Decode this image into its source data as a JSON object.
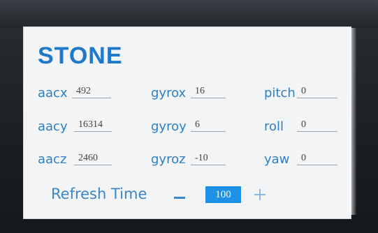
{
  "title": "STONE",
  "accelerometer": {
    "aacx": {
      "label": "aacx",
      "value": "492"
    },
    "aacy": {
      "label": "aacy",
      "value": "16314"
    },
    "aacz": {
      "label": "aacz",
      "value": "2460"
    }
  },
  "gyroscope": {
    "gyrox": {
      "label": "gyrox",
      "value": "16"
    },
    "gyroy": {
      "label": "gyroy",
      "value": "6"
    },
    "gyroz": {
      "label": "gyroz",
      "value": "-10"
    }
  },
  "attitude": {
    "pitch": {
      "label": "pitch",
      "value": "0"
    },
    "roll": {
      "label": "roll",
      "value": "0"
    },
    "yaw": {
      "label": "yaw",
      "value": "0"
    }
  },
  "refresh": {
    "label": "Refresh Time",
    "value": "100",
    "decrement_icon": "minus-icon",
    "increment_icon": "plus-icon"
  },
  "colors": {
    "accent": "#1f78c8",
    "label": "#2f7fc4",
    "value_box": "#1e90e6",
    "screen_bg": "#f2f4f5"
  }
}
